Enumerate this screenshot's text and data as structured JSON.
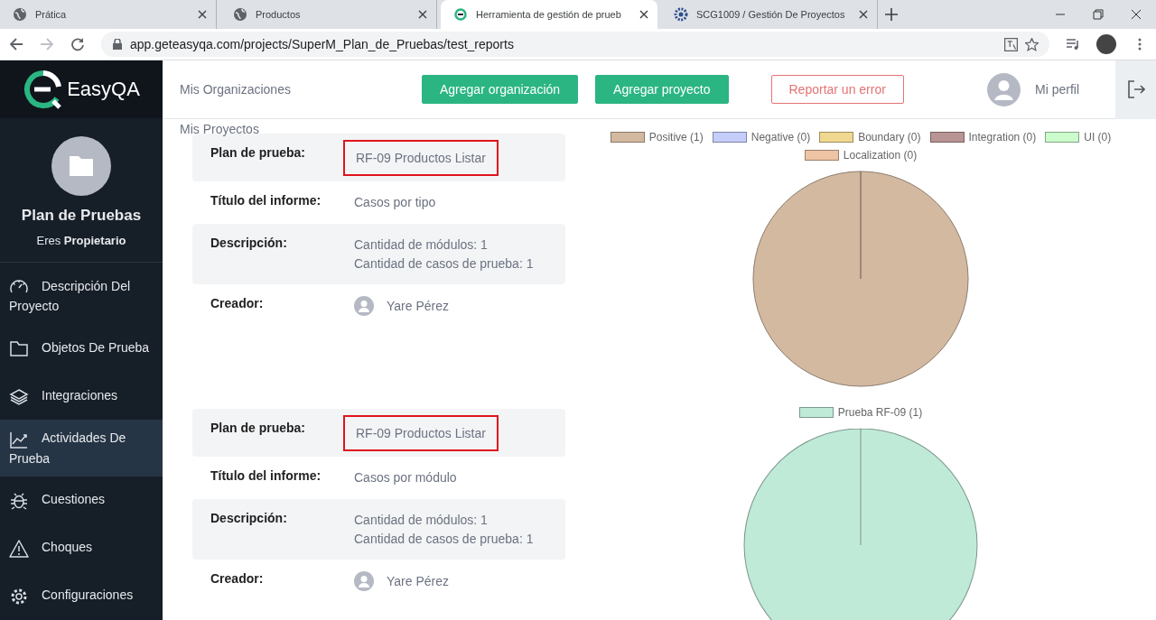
{
  "browser": {
    "tabs": [
      {
        "title": "Prática",
        "kind": "globe",
        "selected": false
      },
      {
        "title": "Productos",
        "kind": "globe",
        "selected": false
      },
      {
        "title": "Herramienta de gestión de prueb",
        "kind": "easyqa",
        "selected": true
      },
      {
        "title": "SCG1009 / Gestión De Proyectos",
        "kind": "gear",
        "selected": false
      }
    ],
    "address": "app.geteasyqa.com/projects/SuperM_Plan_de_Pruebas/test_reports"
  },
  "sidebar": {
    "logo": "EasyQA",
    "project": {
      "name": "Plan de Pruebas",
      "role": "Eres **Propietario**"
    },
    "items": [
      {
        "label": "Descripción Del Proyecto",
        "kind": "gauge",
        "selected": false
      },
      {
        "label": "Objetos De Prueba",
        "kind": "folder",
        "selected": false
      },
      {
        "label": "Integraciones",
        "kind": "layers",
        "selected": false
      },
      {
        "label": "Actividades De Prueba",
        "kind": "chart",
        "selected": true
      },
      {
        "label": "Cuestiones",
        "kind": "bug",
        "selected": false
      },
      {
        "label": "Choques",
        "kind": "warning",
        "selected": false
      },
      {
        "label": "Configuraciones",
        "kind": "gear",
        "selected": false
      }
    ]
  },
  "header": {
    "links": [
      "Mis Organizaciones",
      "Mis Proyectos"
    ],
    "buttons": [
      {
        "label": "Agregar organización",
        "kind": "primary"
      },
      {
        "label": "Agregar proyecto",
        "kind": "primary"
      },
      {
        "label": "Reportar un error",
        "kind": "outline"
      }
    ],
    "profile": "Mi perfil"
  },
  "reports": [
    {
      "plan": {
        "label": "Plan de prueba:",
        "value": "RF-09 Productos Listar",
        "highlighted": true
      },
      "title": {
        "label": "Título del informe:",
        "value": "Casos por tipo"
      },
      "description": {
        "label": "Descripción:",
        "lines": [
          "Cantidad de módulos: 1",
          "Cantidad de casos de prueba: 1"
        ]
      },
      "creator": {
        "label": "Creador:",
        "name": "Yare Pérez"
      },
      "chart_data": {
        "type": "pie",
        "categories": [
          "Positive (1)",
          "Negative (0)",
          "Boundary (0)",
          "Integration (0)",
          "UI (0)",
          "Localization (0)"
        ],
        "values": [
          1,
          0,
          0,
          0,
          0,
          0
        ],
        "colors": [
          "#d2b9a0",
          "#c5cdfb",
          "#f0d890",
          "#b89494",
          "#ccfccc",
          "#eec4a4"
        ]
      }
    },
    {
      "plan": {
        "label": "Plan de prueba:",
        "value": "RF-09 Productos Listar",
        "highlighted": true
      },
      "title": {
        "label": "Título del informe:",
        "value": "Casos por módulo"
      },
      "description": {
        "label": "Descripción:",
        "lines": [
          "Cantidad de módulos: 1",
          "Cantidad de casos de prueba: 1"
        ]
      },
      "creator": {
        "label": "Creador:",
        "name": "Yare Pérez"
      },
      "chart_data": {
        "type": "pie",
        "categories": [
          "Prueba RF-09 (1)"
        ],
        "values": [
          1
        ],
        "colors": [
          "#c0ead8"
        ]
      }
    }
  ]
}
